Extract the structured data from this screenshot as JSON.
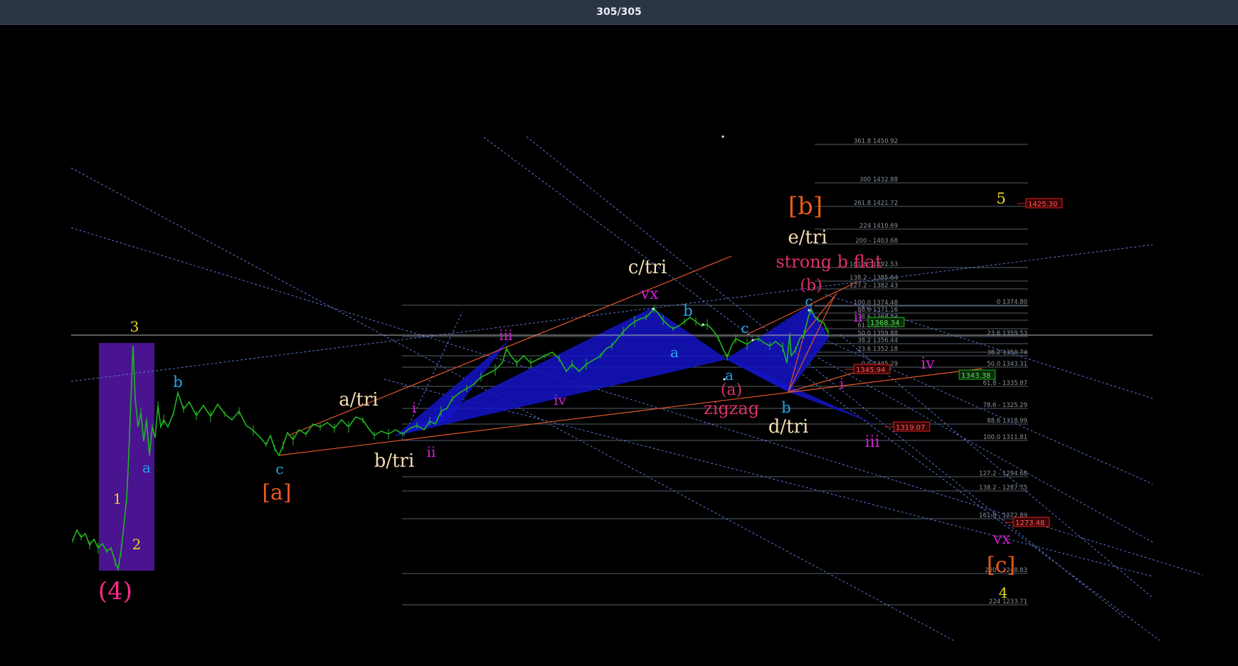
{
  "header": {
    "counter": "305/305"
  },
  "colors": {
    "price": "#22b422",
    "triangle_fill": "#1414c8",
    "trend_orange": "#e0572b",
    "dotted_blue": "#5c76d6",
    "fib_line": "#55606a",
    "fib_text": "#8c9298",
    "purple_box": "#4a1390"
  },
  "chart_data": {
    "type": "line",
    "title": "",
    "series_name": "",
    "price_marker": {
      "label": ""
    },
    "fib_levels": [
      {
        "label": "361.8 1450.92",
        "value": 1450.92
      },
      {
        "label": "300 1432.88",
        "value": 1432.88
      },
      {
        "label": "261.8 1421.72",
        "value": 1421.72
      },
      {
        "label": "224 1410.69",
        "value": 1410.69
      },
      {
        "label": "200 - 1403.68",
        "value": 1403.68
      },
      {
        "label": "161.8 - 1392.53",
        "value": 1392.53
      },
      {
        "label": "138.2 - 1385.64",
        "value": 1385.64
      },
      {
        "label": "127.2 - 1382.43",
        "value": 1382.43
      },
      {
        "label": "100.0 1374.48",
        "value": 1374.48
      },
      {
        "label": "88.6 1371.16",
        "value": 1371.16
      },
      {
        "label": "78.6 1368.23",
        "value": 1368.23
      },
      {
        "label": "61.8 1363.33",
        "value": 1363.33
      },
      {
        "label": "50.0 1359.88",
        "value": 1359.88
      },
      {
        "label": "38.2 1356.44",
        "value": 1356.44
      },
      {
        "label": "23.6 1352.18",
        "value": 1352.18
      },
      {
        "label": "0.0 1345.29",
        "value": 1345.29
      },
      {
        "label": "0 1374.80",
        "value": 1374.8
      },
      {
        "label": "23.6 1359.53",
        "value": 1359.53
      },
      {
        "label": "38.2 1350.74",
        "value": 1350.74
      },
      {
        "label": "50.0 1343.31",
        "value": 1343.31
      },
      {
        "label": "61.8 - 1335.87",
        "value": 1335.87
      },
      {
        "label": "78.6 - 1325.29",
        "value": 1325.29
      },
      {
        "label": "88.6 1318.99",
        "value": 1318.99
      },
      {
        "label": "100.0 1311.81",
        "value": 1311.81
      },
      {
        "label": "127.2 - 1294.68",
        "value": 1294.68
      },
      {
        "label": "138.2 - 1287.75",
        "value": 1287.75
      },
      {
        "label": "161.8 - 1272.89",
        "value": 1272.89
      },
      {
        "label": "200 - 1248.83",
        "value": 1248.83
      },
      {
        "label": "224 1233.71",
        "value": 1233.71
      }
    ],
    "price_tags": [
      {
        "label": "1425.30",
        "color": "#e02020"
      },
      {
        "label": "1368.34",
        "color": "#22b422"
      },
      {
        "label": "1345.94",
        "color": "#e02020"
      },
      {
        "label": "1343.38",
        "color": "#22b422"
      },
      {
        "label": "1319.07",
        "color": "#e02020"
      },
      {
        "label": "1273.48",
        "color": "#e02020"
      }
    ],
    "wave_labels": [
      {
        "text": "(4)",
        "color": "#ff2a8a"
      },
      {
        "text": "3",
        "color": "#e8d820"
      },
      {
        "text": "1",
        "color": "#e8d820"
      },
      {
        "text": "2",
        "color": "#e8d820"
      },
      {
        "text": "a",
        "color": "#22a8e8"
      },
      {
        "text": "b",
        "color": "#22a8e8"
      },
      {
        "text": "c",
        "color": "#22a8e8"
      },
      {
        "text": "[a]",
        "color": "#e85a1a"
      },
      {
        "text": "a/tri",
        "color": "#f3dcb0"
      },
      {
        "text": "b/tri",
        "color": "#f3dcb0"
      },
      {
        "text": "i",
        "color": "#d020d0"
      },
      {
        "text": "ii",
        "color": "#d020d0"
      },
      {
        "text": "iii",
        "color": "#d020d0"
      },
      {
        "text": "iv",
        "color": "#d020d0"
      },
      {
        "text": "vx",
        "color": "#d020d0"
      },
      {
        "text": "c/tri",
        "color": "#f3dcb0"
      },
      {
        "text": "b",
        "color": "#22a8e8"
      },
      {
        "text": "a",
        "color": "#22a8e8"
      },
      {
        "text": "c",
        "color": "#22a8e8"
      },
      {
        "text": "a",
        "color": "#22a8e8"
      },
      {
        "text": "(a)",
        "color": "#e0306a"
      },
      {
        "text": "zigzag",
        "color": "#e0306a"
      },
      {
        "text": "b",
        "color": "#22a8e8"
      },
      {
        "text": "d/tri",
        "color": "#f3dcb0"
      },
      {
        "text": "c",
        "color": "#22a8e8"
      },
      {
        "text": "(b)",
        "color": "#e0306a"
      },
      {
        "text": "strong b flat",
        "color": "#e0306a"
      },
      {
        "text": "e/tri",
        "color": "#f3dcb0"
      },
      {
        "text": "[b]",
        "color": "#e85a1a"
      },
      {
        "text": "ii",
        "color": "#d020d0"
      },
      {
        "text": "i",
        "color": "#d020d0"
      },
      {
        "text": "iii",
        "color": "#d020d0"
      },
      {
        "text": "iv",
        "color": "#d020d0"
      },
      {
        "text": "5",
        "color": "#e8d820"
      },
      {
        "text": "vx",
        "color": "#d020d0"
      },
      {
        "text": "[c]",
        "color": "#e85a1a"
      },
      {
        "text": "4",
        "color": "#e8d820"
      }
    ]
  }
}
